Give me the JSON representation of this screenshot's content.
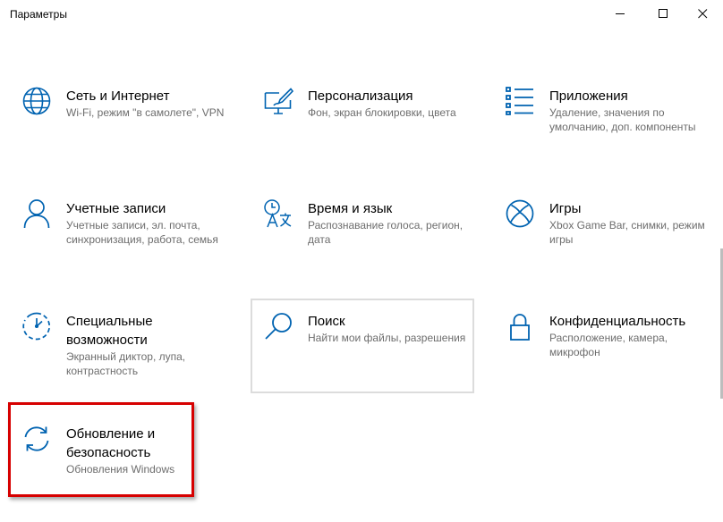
{
  "window": {
    "title": "Параметры"
  },
  "tiles": [
    {
      "title": "Сеть и Интернет",
      "desc": "Wi-Fi, режим \"в самолете\", VPN",
      "icon": "globe-icon"
    },
    {
      "title": "Персонализация",
      "desc": "Фон, экран блокировки, цвета",
      "icon": "personalization-icon"
    },
    {
      "title": "Приложения",
      "desc": "Удаление, значения по умолчанию, доп. компоненты",
      "icon": "apps-list-icon"
    },
    {
      "title": "Учетные записи",
      "desc": "Учетные записи, эл. почта, синхронизация, работа, семья",
      "icon": "person-icon"
    },
    {
      "title": "Время и язык",
      "desc": "Распознавание голоса, регион, дата",
      "icon": "time-language-icon"
    },
    {
      "title": "Игры",
      "desc": "Xbox Game Bar, снимки, режим игры",
      "icon": "xbox-icon"
    },
    {
      "title": "Специальные возможности",
      "desc": "Экранный диктор, лупа, контрастность",
      "icon": "accessibility-icon"
    },
    {
      "title": "Поиск",
      "desc": "Найти мои файлы, разрешения",
      "icon": "search-icon"
    },
    {
      "title": "Конфиденциальность",
      "desc": "Расположение, камера, микрофон",
      "icon": "lock-icon"
    },
    {
      "title": "Обновление и безопасность",
      "desc": "Обновления Windows",
      "icon": "update-sync-icon"
    }
  ],
  "colors": {
    "accent": "#0063b1",
    "highlight": "#d60000",
    "description": "#6d6d6d"
  }
}
